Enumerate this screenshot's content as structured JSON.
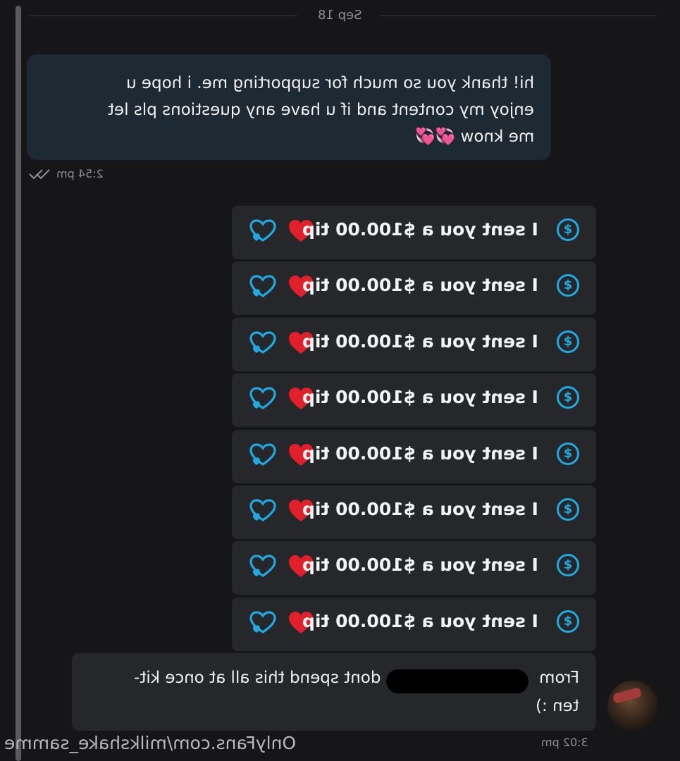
{
  "date_separator": "Sep 18",
  "incoming_message": {
    "lines": [
      "hi! thank you so much for supporting me. i hope u",
      "enjoy my content and if u have any questions pls let",
      "me know 💞💞"
    ],
    "time": "2:54 pm"
  },
  "tips": [
    {
      "text": "I sent you a $100.00 tip",
      "coin_icon": "dollar-coin-icon",
      "heart_icon": "red-heart-icon",
      "like_icon": "heart-outline-icon"
    },
    {
      "text": "I sent you a $100.00 tip",
      "coin_icon": "dollar-coin-icon",
      "heart_icon": "red-heart-icon",
      "like_icon": "heart-outline-icon"
    },
    {
      "text": "I sent you a $100.00 tip",
      "coin_icon": "dollar-coin-icon",
      "heart_icon": "red-heart-icon",
      "like_icon": "heart-outline-icon"
    },
    {
      "text": "I sent you a $100.00 tip",
      "coin_icon": "dollar-coin-icon",
      "heart_icon": "red-heart-icon",
      "like_icon": "heart-outline-icon"
    },
    {
      "text": "I sent you a $100.00 tip",
      "coin_icon": "dollar-coin-icon",
      "heart_icon": "red-heart-icon",
      "like_icon": "heart-outline-icon"
    },
    {
      "text": "I sent you a $100.00 tip",
      "coin_icon": "dollar-coin-icon",
      "heart_icon": "red-heart-icon",
      "like_icon": "heart-outline-icon"
    },
    {
      "text": "I sent you a $100.00 tip",
      "coin_icon": "dollar-coin-icon",
      "heart_icon": "red-heart-icon",
      "like_icon": "heart-outline-icon"
    },
    {
      "text": "I sent you a $100.00 tip",
      "coin_icon": "dollar-coin-icon",
      "heart_icon": "red-heart-icon",
      "like_icon": "heart-outline-icon"
    }
  ],
  "outgoing_message": {
    "line1_from": "From",
    "line1_rest": "dont spend this all at once kit-",
    "line2": "ten :)",
    "time": "3:02 pm"
  },
  "coin_symbol": "$",
  "watermark": "OnlyFans.com/milkshake_samme",
  "colors": {
    "background": "#161618",
    "incoming_bubble": "#1d2a33",
    "outgoing_bubble": "#26272b",
    "accent_blue": "#1fa9e0",
    "heart_red": "#e0202a"
  }
}
